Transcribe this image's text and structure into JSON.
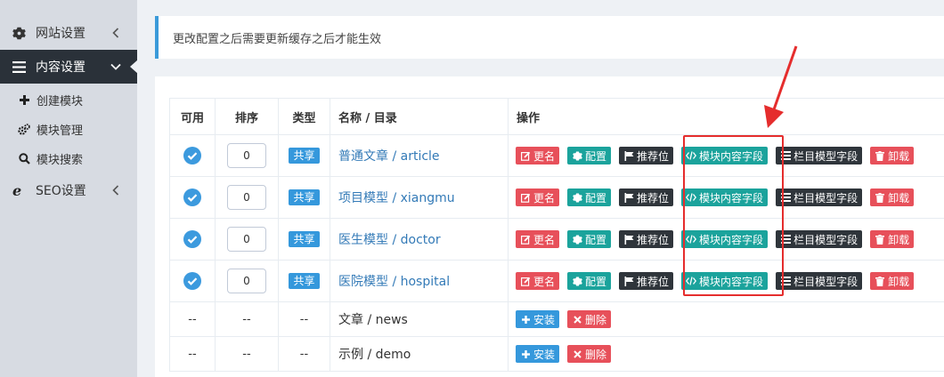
{
  "sidebar": {
    "items": [
      {
        "label": "网站设置",
        "icon": "gear-icon"
      },
      {
        "label": "内容设置",
        "icon": "menu-lines-icon"
      },
      {
        "label": "SEO设置",
        "icon": "ie-icon"
      }
    ],
    "submenu": [
      {
        "label": "创建模块",
        "icon": "plus-icon"
      },
      {
        "label": "模块管理",
        "icon": "cogs-icon"
      },
      {
        "label": "模块搜索",
        "icon": "search-icon"
      }
    ]
  },
  "notice": {
    "text": "更改配置之后需要更新缓存之后才能生效"
  },
  "table": {
    "headers": [
      "可用",
      "排序",
      "类型",
      "名称 / 目录",
      "操作"
    ],
    "rows": [
      {
        "sort": "0",
        "type": "共享",
        "name": "普通文章 / article"
      },
      {
        "sort": "0",
        "type": "共享",
        "name": "项目模型 / xiangmu"
      },
      {
        "sort": "0",
        "type": "共享",
        "name": "医生模型 / doctor"
      },
      {
        "sort": "0",
        "type": "共享",
        "name": "医院模型 / hospital"
      }
    ],
    "uninstalled": [
      {
        "name": "文章 / news"
      },
      {
        "name": "示例 / demo"
      }
    ],
    "dash": "--",
    "actions": {
      "rename": "更名",
      "config": "配置",
      "recommend": "推荐位",
      "module_fields": "模块内容字段",
      "column_fields": "栏目模型字段",
      "uninstall": "卸载",
      "install": "安装",
      "delete": "删除"
    }
  },
  "colors": {
    "accent": "#3598dc",
    "danger": "#e7505a",
    "success": "#1ba39c",
    "dark": "#2f353b",
    "highlight": "#e52d2d"
  }
}
